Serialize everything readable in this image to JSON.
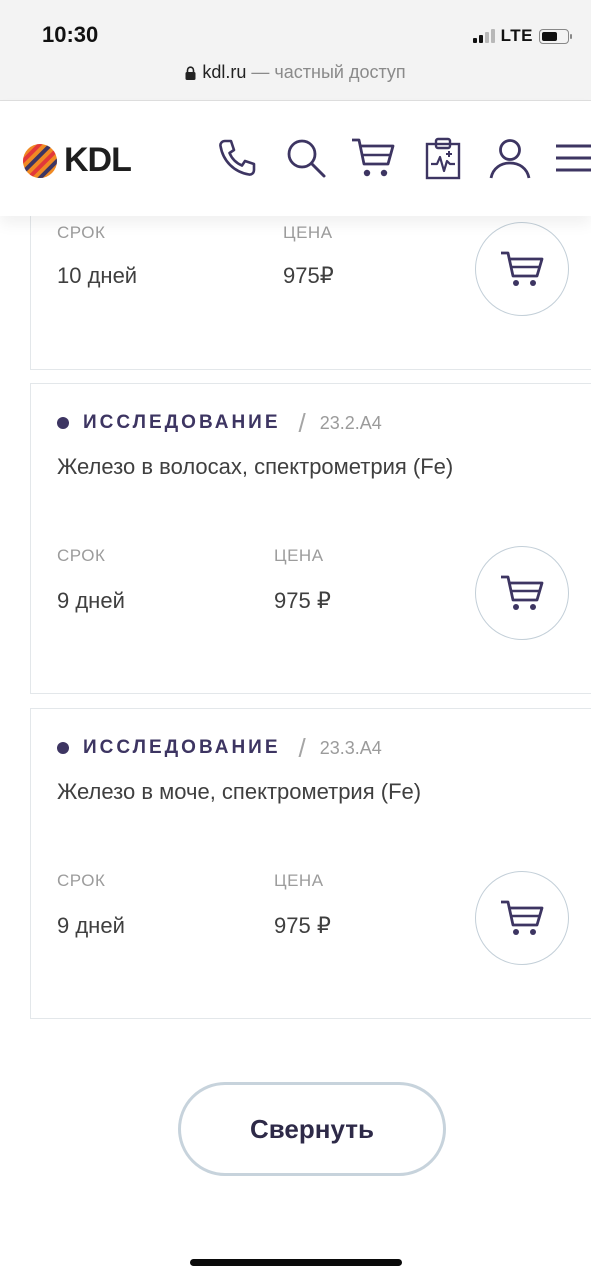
{
  "status_bar": {
    "time": "10:30",
    "network": "LTE",
    "battery_level": 0.6
  },
  "address_bar": {
    "domain": "kdl.ru",
    "suffix": "— частный доступ",
    "lock_icon": "lock-icon"
  },
  "header": {
    "logo_text": "KDL",
    "icons": [
      "phone-icon",
      "search-icon",
      "cart-icon",
      "medical-record-icon",
      "user-icon",
      "menu-icon"
    ],
    "icon_color": "#3d3562"
  },
  "labels": {
    "term": "СРОК",
    "price": "ЦЕНА",
    "collapse": "Свернуть"
  },
  "cards": [
    {
      "term_value": "10 дней",
      "price_value": "975₽"
    },
    {
      "tag": "ИССЛЕДОВАНИЕ",
      "separator": "/",
      "code": "23.2.A4",
      "title": "Железо в волосах, спектрометрия (Fe)",
      "term_value": "9 дней",
      "price_value": "975 ₽"
    },
    {
      "tag": "ИССЛЕДОВАНИЕ",
      "separator": "/",
      "code": "23.3.A4",
      "title": "Железо в моче, спектрометрия (Fe)",
      "term_value": "9 дней",
      "price_value": "975 ₽"
    }
  ],
  "colors": {
    "accent": "#3d3562",
    "border": "#e3e7ea",
    "muted_text": "#9c9c9c"
  }
}
